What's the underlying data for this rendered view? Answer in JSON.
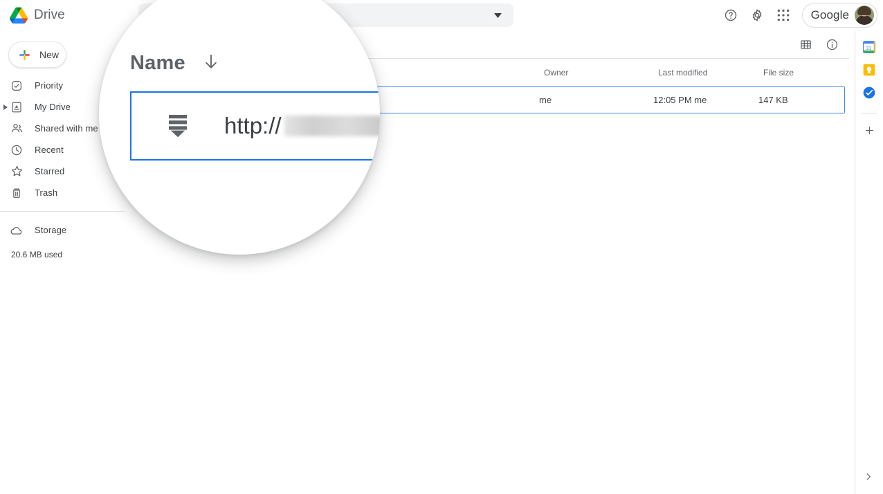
{
  "app": {
    "brand_name": "Drive",
    "logo_icon": "google-drive-logo"
  },
  "search": {
    "value": "",
    "placeholder": "",
    "caret_icon": "chevron-down-icon"
  },
  "topbar": {
    "help_icon": "help-circle-icon",
    "settings_icon": "gear-icon",
    "apps_icon": "apps-grid-icon",
    "account_word": "Google",
    "avatar_icon": "user-avatar"
  },
  "sidebar": {
    "new_button": {
      "label": "New",
      "icon": "plus-icon"
    },
    "items": [
      {
        "label": "Priority",
        "icon": "priority-check-icon",
        "expandable": false
      },
      {
        "label": "My Drive",
        "icon": "my-drive-icon",
        "expandable": true
      },
      {
        "label": "Shared with me",
        "icon": "people-icon",
        "expandable": false
      },
      {
        "label": "Recent",
        "icon": "clock-icon",
        "expandable": false
      },
      {
        "label": "Starred",
        "icon": "star-icon",
        "expandable": false
      },
      {
        "label": "Trash",
        "icon": "trash-icon",
        "expandable": false
      }
    ],
    "storage": {
      "label": "Storage",
      "icon": "cloud-icon",
      "used": "20.6 MB used"
    }
  },
  "main": {
    "toolbar": {
      "grid_view_icon": "grid-view-icon",
      "details_icon": "info-circle-icon"
    },
    "columns": {
      "name": "Name",
      "sort_icon": "arrow-down-icon",
      "owner": "Owner",
      "last_modified": "Last modified",
      "file_size": "File size"
    },
    "rows": [
      {
        "icon": "link-shortcut-icon",
        "name": "",
        "name_suffix": ".",
        "name_redacted": true,
        "owner": "me",
        "last_modified": "12:05 PM me",
        "file_size": "147 KB",
        "selected": true
      }
    ]
  },
  "right_panel": {
    "apps": [
      {
        "name": "google-calendar-icon"
      },
      {
        "name": "google-keep-icon"
      },
      {
        "name": "google-tasks-icon"
      }
    ],
    "add_icon": "plus-icon",
    "expand_icon": "chevron-right-icon"
  },
  "magnifier": {
    "header_label": "Name",
    "header_sort_icon": "arrow-down-icon",
    "row_icon": "link-shortcut-icon",
    "row_text": "http://",
    "row_redacted": true
  },
  "colors": {
    "accent_blue": "#1a73e8",
    "selection_border": "#4285f4",
    "text_primary": "#3c4043",
    "text_secondary": "#5f6368",
    "divider": "#e0e0e0",
    "search_bg": "#f1f3f4"
  }
}
